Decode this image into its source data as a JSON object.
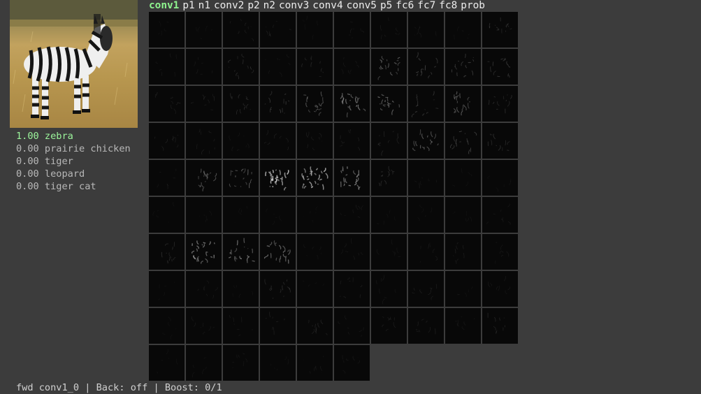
{
  "layer_tabs": [
    {
      "label": "conv1",
      "active": true
    },
    {
      "label": "p1",
      "active": false
    },
    {
      "label": "n1",
      "active": false
    },
    {
      "label": "conv2",
      "active": false
    },
    {
      "label": "p2",
      "active": false
    },
    {
      "label": "n2",
      "active": false
    },
    {
      "label": "conv3",
      "active": false
    },
    {
      "label": "conv4",
      "active": false
    },
    {
      "label": "conv5",
      "active": false
    },
    {
      "label": "p5",
      "active": false
    },
    {
      "label": "fc6",
      "active": false
    },
    {
      "label": "fc7",
      "active": false
    },
    {
      "label": "fc8",
      "active": false
    },
    {
      "label": "prob",
      "active": false
    }
  ],
  "predictions": [
    {
      "text": "1.00 zebra"
    },
    {
      "text": "0.00 prairie chicken"
    },
    {
      "text": "0.00 tiger"
    },
    {
      "text": "0.00 leopard"
    },
    {
      "text": "0.00 tiger cat"
    }
  ],
  "status_bar": {
    "mode": "fwd conv1_0",
    "sep1": " | ",
    "back": "Back: off",
    "sep2": " | ",
    "boost": "Boost: 0/1"
  },
  "grid": {
    "filter_count": 96,
    "brightness": [
      0.05,
      0.05,
      0.15,
      0.15,
      0.05,
      0.1,
      0.1,
      0.1,
      0.05,
      0.25,
      0.1,
      0.1,
      0.25,
      0.1,
      0.2,
      0.1,
      0.45,
      0.35,
      0.35,
      0.3,
      0.15,
      0.15,
      0.25,
      0.3,
      0.45,
      0.55,
      0.5,
      0.3,
      0.45,
      0.25,
      0.15,
      0.15,
      0.1,
      0.15,
      0.15,
      0.15,
      0.2,
      0.45,
      0.35,
      0.25,
      0.1,
      0.45,
      0.45,
      0.8,
      0.75,
      0.6,
      0.25,
      0.1,
      0.05,
      0.05,
      0.05,
      0.05,
      0.05,
      0.05,
      0.05,
      0.1,
      0.05,
      0.05,
      0.05,
      0.1,
      0.25,
      0.6,
      0.55,
      0.55,
      0.08,
      0.1,
      0.08,
      0.1,
      0.15,
      0.1,
      0.05,
      0.1,
      0.05,
      0.25,
      0.05,
      0.15,
      0.1,
      0.15,
      0.05,
      0.1,
      0.05,
      0.1,
      0.1,
      0.15,
      0.2,
      0.1,
      0.15,
      0.15,
      0.1,
      0.2,
      0.05,
      0.05,
      0.1,
      0.05,
      0.1,
      0.1
    ],
    "cell_color": "#080808",
    "gap_color": "#3c3c3c"
  },
  "colors": {
    "background": "#3c3c3c",
    "active_tab": "#8ff58f",
    "top_prediction": "#9cf59c",
    "text": "#d4d4d4"
  },
  "icons": {
    "input_image": "zebra-photo"
  }
}
